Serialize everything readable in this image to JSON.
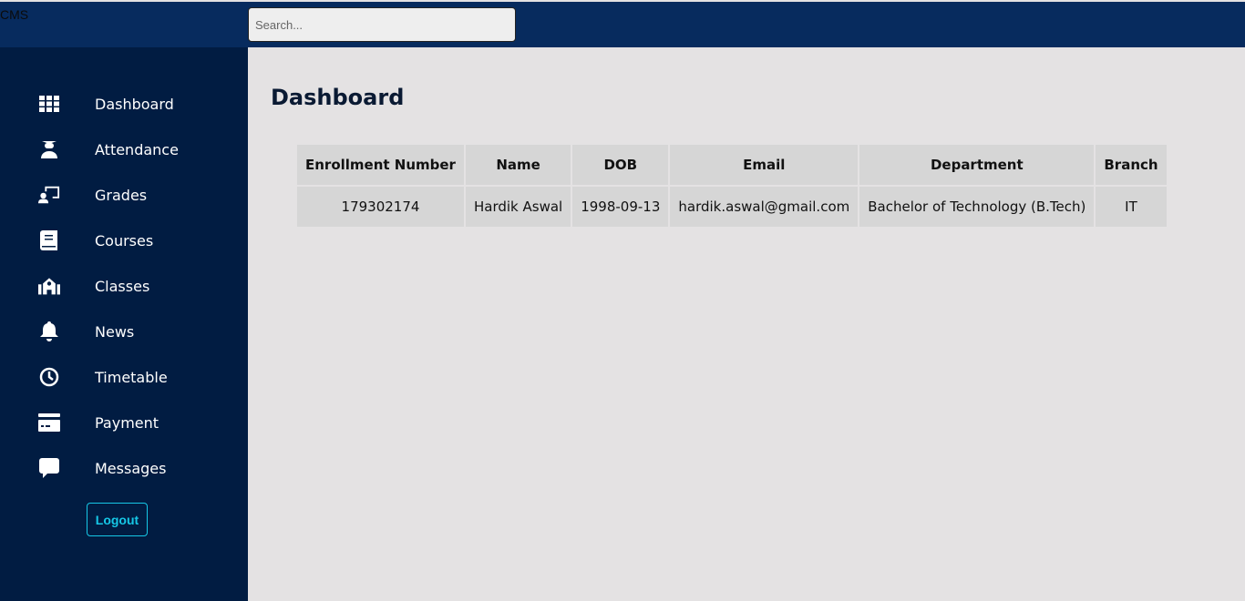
{
  "header": {
    "brand": "CMS",
    "search_placeholder": "Search..."
  },
  "sidebar": {
    "items": [
      {
        "label": "Dashboard",
        "icon": "grid-icon"
      },
      {
        "label": "Attendance",
        "icon": "graduate-icon"
      },
      {
        "label": "Grades",
        "icon": "teacher-board-icon"
      },
      {
        "label": "Courses",
        "icon": "book-icon"
      },
      {
        "label": "Classes",
        "icon": "school-icon"
      },
      {
        "label": "News",
        "icon": "bell-icon"
      },
      {
        "label": "Timetable",
        "icon": "clock-icon"
      },
      {
        "label": "Payment",
        "icon": "credit-card-icon"
      },
      {
        "label": "Messages",
        "icon": "message-icon"
      }
    ],
    "logout": "Logout"
  },
  "main": {
    "title": "Dashboard",
    "table": {
      "headers": [
        "Enrollment Number",
        "Name",
        "DOB",
        "Email",
        "Department",
        "Branch"
      ],
      "rows": [
        [
          "179302174",
          "Hardik Aswal",
          "1998-09-13",
          "hardik.aswal@gmail.com",
          "Bachelor of Technology (B.Tech)",
          "IT"
        ]
      ]
    }
  }
}
